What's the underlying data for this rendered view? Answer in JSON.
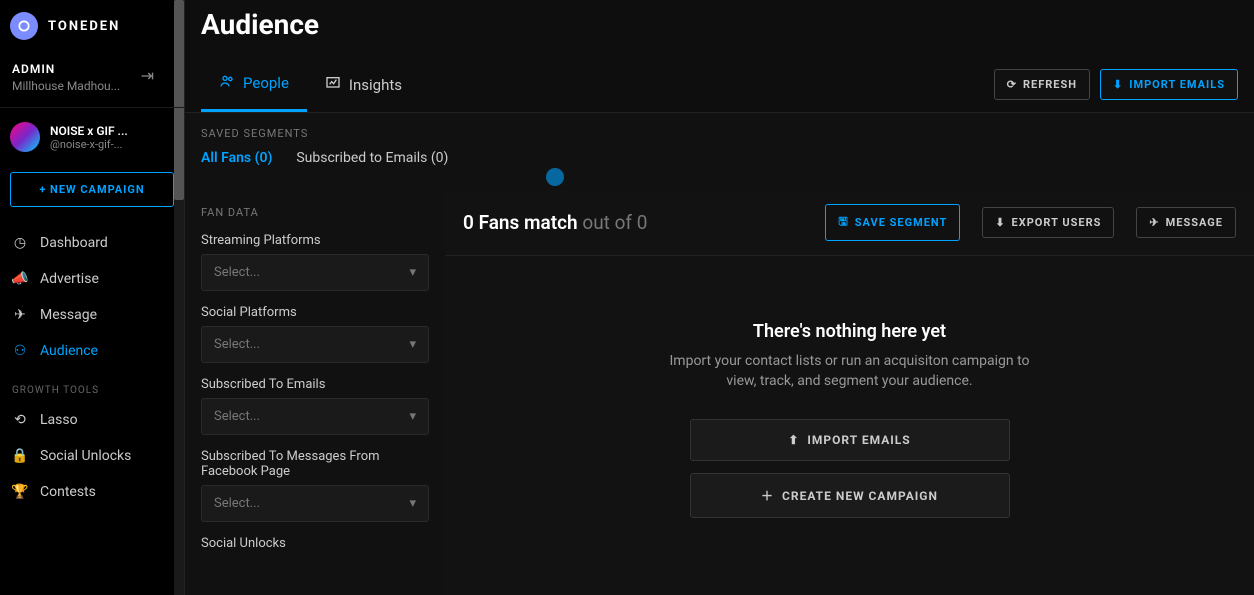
{
  "brand": {
    "name": "TONEDEN"
  },
  "admin": {
    "label": "ADMIN",
    "sub": "Millhouse Madhou..."
  },
  "profile": {
    "name": "NOISE x GIF ...",
    "handle": "@noise-x-gif-..."
  },
  "newCampaign": "+ NEW CAMPAIGN",
  "nav": {
    "dashboard": "Dashboard",
    "advertise": "Advertise",
    "message": "Message",
    "audience": "Audience"
  },
  "growthLabel": "GROWTH TOOLS",
  "growth": {
    "lasso": "Lasso",
    "socialUnlocks": "Social Unlocks",
    "contests": "Contests"
  },
  "pageTitle": "Audience",
  "tabs": {
    "people": "People",
    "insights": "Insights"
  },
  "actions": {
    "refresh": "REFRESH",
    "importEmails": "IMPORT EMAILS"
  },
  "segmentsLabel": "SAVED SEGMENTS",
  "segments": {
    "allFans": "All Fans (0)",
    "subscribed": "Subscribed to Emails (0)"
  },
  "fanDataLabel": "FAN DATA",
  "filters": {
    "streaming": "Streaming Platforms",
    "social": "Social Platforms",
    "emails": "Subscribed To Emails",
    "fbMessages": "Subscribed To Messages From Facebook Page",
    "socialUnlocks": "Social Unlocks",
    "placeholder": "Select..."
  },
  "results": {
    "matchCount": "0 Fans match",
    "outOf": "out of 0",
    "saveSegment": "SAVE SEGMENT",
    "exportUsers": "EXPORT USERS",
    "message": "MESSAGE"
  },
  "empty": {
    "title": "There's nothing here yet",
    "sub": "Import your contact lists or run an acquisiton campaign to view, track, and segment your audience.",
    "importEmails": "IMPORT EMAILS",
    "createCampaign": "CREATE NEW CAMPAIGN"
  }
}
